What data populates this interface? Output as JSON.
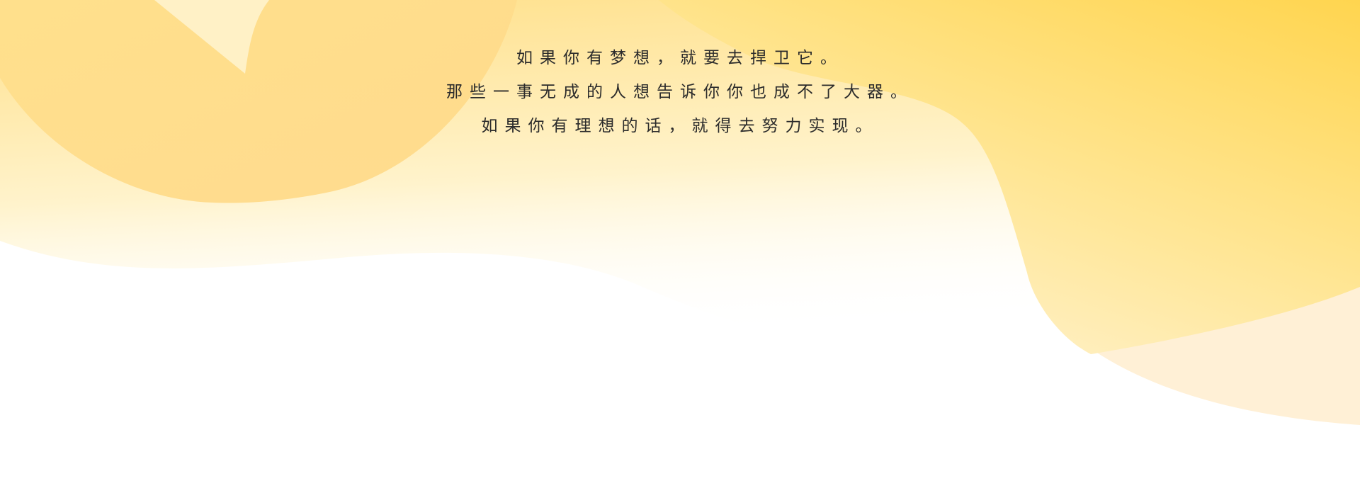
{
  "quote": {
    "lines": [
      "如果你有梦想，就要去捍卫它。",
      "那些一事无成的人想告诉你你也成不了大器。",
      "如果你有理想的话，就得去努力实现。"
    ]
  },
  "colors": {
    "yellow_deep": "#FFD54F",
    "yellow_mid": "#FFE08A",
    "yellow_light": "#FFF3CC",
    "peach": "#FFF0D6",
    "text": "#2B2B2B",
    "background": "#FFFFFF"
  }
}
